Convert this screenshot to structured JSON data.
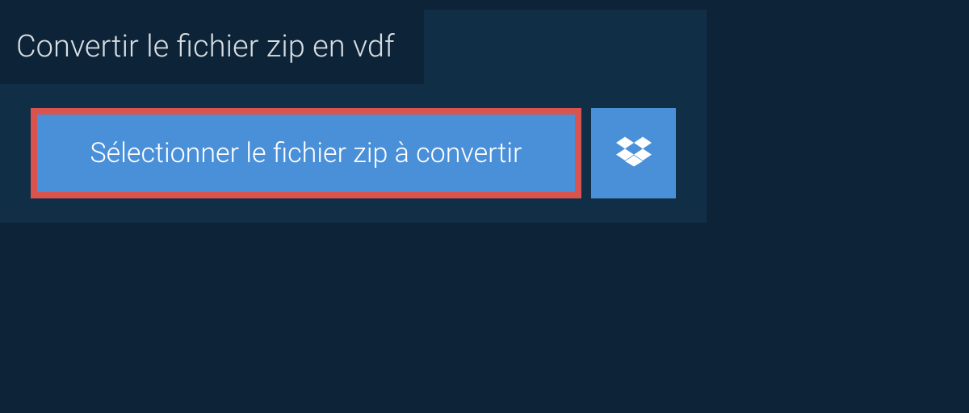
{
  "title": "Convertir le fichier zip en vdf",
  "select_button_label": "Sélectionner le fichier zip à convertir"
}
